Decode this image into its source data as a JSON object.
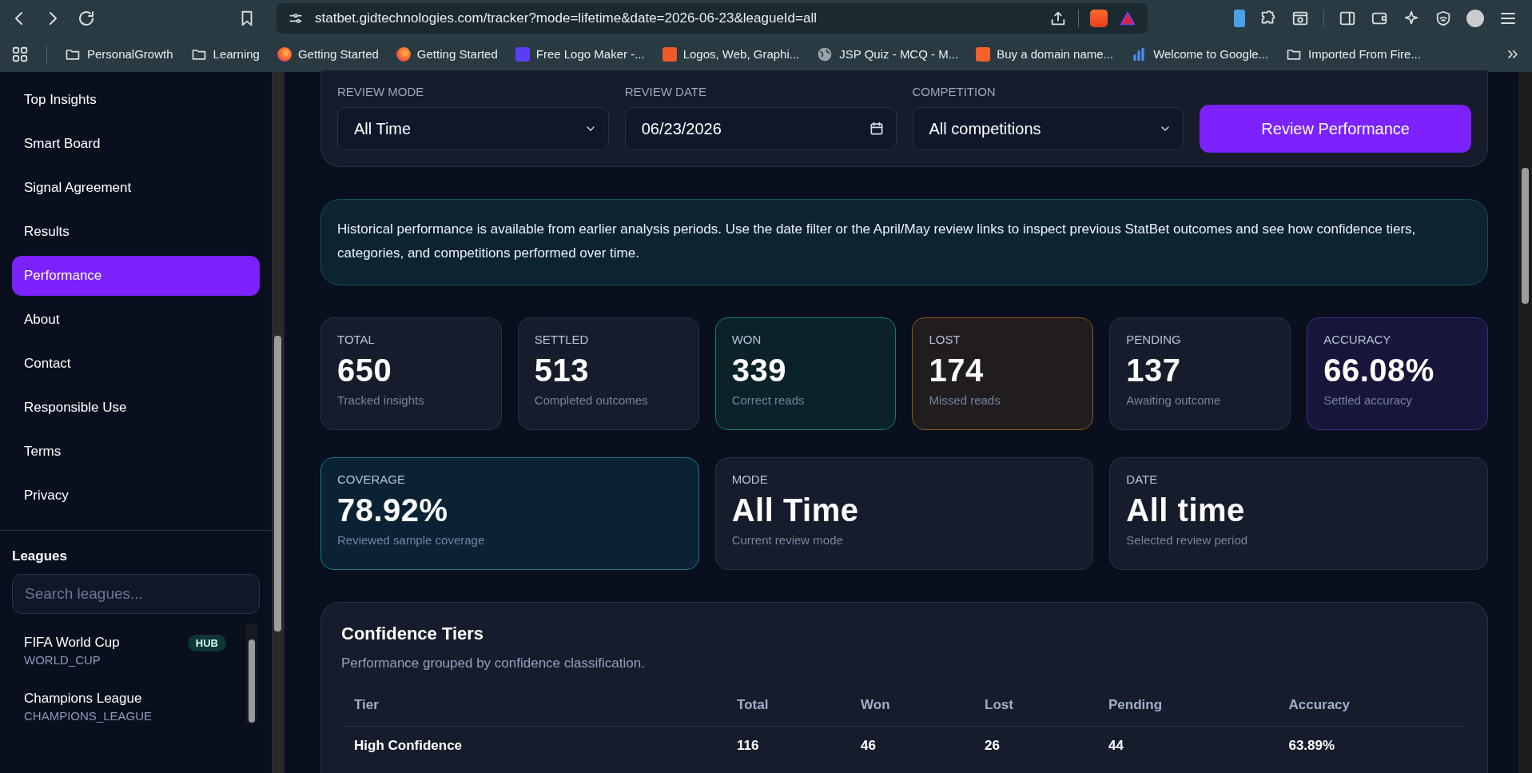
{
  "browser": {
    "url": "statbet.gidtechnologies.com/tracker?mode=lifetime&date=2026-06-23&leagueId=all",
    "bookmarks": [
      {
        "label": "PersonalGrowth",
        "kind": "folder"
      },
      {
        "label": "Learning",
        "kind": "folder"
      },
      {
        "label": "Getting Started",
        "kind": "firefox"
      },
      {
        "label": "Getting Started",
        "kind": "firefox"
      },
      {
        "label": "Free Logo Maker -...",
        "kind": "tile",
        "color": "#5b3df5"
      },
      {
        "label": "Logos, Web, Graphi...",
        "kind": "tile",
        "color": "#f05a28"
      },
      {
        "label": "JSP Quiz - MCQ - M...",
        "kind": "globe"
      },
      {
        "label": "Buy a domain name...",
        "kind": "tile",
        "color": "#f4622b"
      },
      {
        "label": "Welcome to Google...",
        "kind": "chart"
      },
      {
        "label": "Imported From Fire...",
        "kind": "folder"
      }
    ]
  },
  "sidebar": {
    "items": [
      {
        "label": "Top Insights",
        "selected": false
      },
      {
        "label": "Smart Board",
        "selected": false
      },
      {
        "label": "Signal Agreement",
        "selected": false
      },
      {
        "label": "Results",
        "selected": false
      },
      {
        "label": "Performance",
        "selected": true
      },
      {
        "label": "About",
        "selected": false
      },
      {
        "label": "Contact",
        "selected": false
      },
      {
        "label": "Responsible Use",
        "selected": false
      },
      {
        "label": "Terms",
        "selected": false
      },
      {
        "label": "Privacy",
        "selected": false
      }
    ],
    "leagues_heading": "Leagues",
    "search": {
      "placeholder": "Search leagues..."
    },
    "leagues": [
      {
        "name": "FIFA World Cup",
        "code": "WORLD_CUP",
        "badge": "HUB"
      },
      {
        "name": "Champions League",
        "code": "CHAMPIONS_LEAGUE"
      }
    ]
  },
  "filters": {
    "fields": [
      {
        "label": "REVIEW MODE",
        "kind": "select",
        "value": "All Time"
      },
      {
        "label": "REVIEW DATE",
        "kind": "date",
        "value": "06/23/2026"
      },
      {
        "label": "COMPETITION",
        "kind": "select",
        "value": "All competitions"
      }
    ],
    "button": "Review Performance"
  },
  "notice": "Historical performance is available from earlier analysis periods. Use the date filter or the April/May review links to inspect previous StatBet outcomes and see how confidence tiers, categories, and competitions performed over time.",
  "stats": [
    {
      "label": "TOTAL",
      "value": "650",
      "caption": "Tracked insights",
      "kind": "neutral"
    },
    {
      "label": "SETTLED",
      "value": "513",
      "caption": "Completed outcomes",
      "kind": "neutral"
    },
    {
      "label": "WON",
      "value": "339",
      "caption": "Correct reads",
      "kind": "won"
    },
    {
      "label": "LOST",
      "value": "174",
      "caption": "Missed reads",
      "kind": "lost"
    },
    {
      "label": "PENDING",
      "value": "137",
      "caption": "Awaiting outcome",
      "kind": "neutral"
    },
    {
      "label": "ACCURACY",
      "value": "66.08%",
      "caption": "Settled accuracy",
      "kind": "accuracy"
    }
  ],
  "summary": [
    {
      "label": "COVERAGE",
      "value": "78.92%",
      "caption": "Reviewed sample coverage",
      "kind": "coverage"
    },
    {
      "label": "MODE",
      "value": "All Time",
      "caption": "Current review mode",
      "kind": "neutral"
    },
    {
      "label": "DATE",
      "value": "All time",
      "caption": "Selected review period",
      "kind": "neutral"
    }
  ],
  "tiers": {
    "title": "Confidence Tiers",
    "subtitle": "Performance grouped by confidence classification.",
    "columns": [
      "Tier",
      "Total",
      "Won",
      "Lost",
      "Pending",
      "Accuracy"
    ],
    "rows": [
      [
        "High Confidence",
        "116",
        "46",
        "26",
        "44",
        "63.89%"
      ]
    ]
  }
}
